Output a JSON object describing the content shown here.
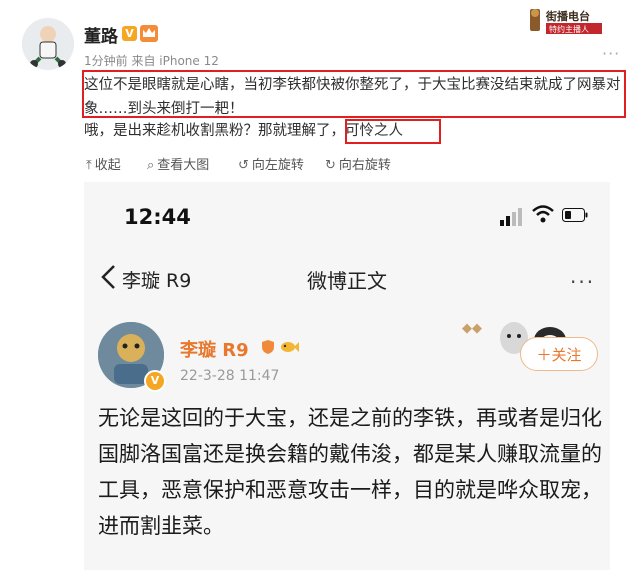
{
  "post": {
    "author": "董路",
    "v_badge": "V",
    "meta": "1分钟前 来自 iPhone 12",
    "text_boxed": "这位不是眼瞎就是心瞎，当初李铁都快被你整死了，于大宝比赛没结束就成了网暴对象……到头来倒打一耙！",
    "text_line3_prefix": "哦，是出来趁机收割黑粉？那就理解了，",
    "text_line3_boxed": "可怜之人",
    "watermark_line1": "街播电台",
    "watermark_line2": "特约主播人",
    "more": "···"
  },
  "toolbar": [
    {
      "icon": "shrink-icon",
      "glyph": "⤒",
      "label": "收起"
    },
    {
      "icon": "zoom-icon",
      "glyph": "⌕",
      "label": "查看大图"
    },
    {
      "icon": "rotate-left-icon",
      "glyph": "↺",
      "label": "向左旋转"
    },
    {
      "icon": "rotate-right-icon",
      "glyph": "↻",
      "label": "向右旋转"
    }
  ],
  "phone": {
    "time": "12:44",
    "nav_username": "李璇 R9",
    "nav_title": "微博正文",
    "nav_more": "···",
    "author": "李璇 R9",
    "verify_badge": "V",
    "date": "22-3-28 11:47",
    "follow_label": "＋关注",
    "body": "无论是这回的于大宝，还是之前的李铁，再或者是归化国脚洛国富还是换会籍的戴伟浚，都是某人赚取流量的工具，恶意保护和恶意攻击一样，目的就是哗众取宠，进而割韭菜。",
    "accent_color": "#e8782d"
  },
  "colors": {
    "highlight_box": "#e02020",
    "meta_gray": "#8a8a8a"
  }
}
